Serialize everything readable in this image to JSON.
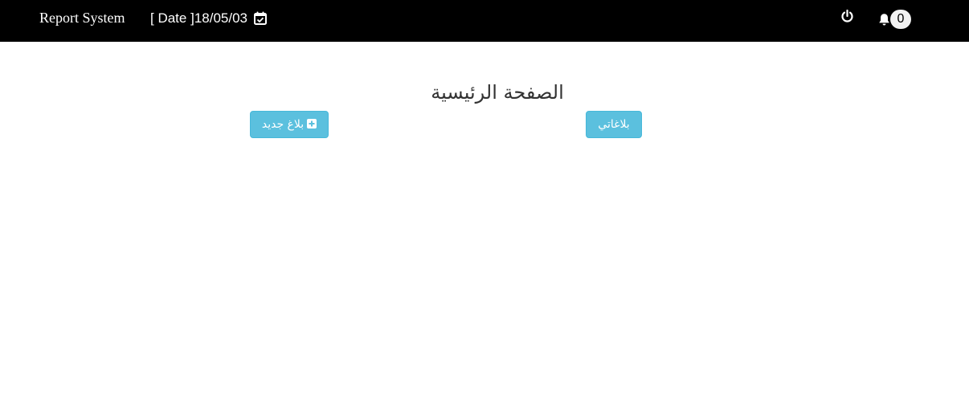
{
  "navbar": {
    "brand": "Report System",
    "date_label": "[ Date ]",
    "date_value": "18/05/03",
    "notification_count": "0",
    "icons": [
      "calendar-check-icon",
      "power-icon",
      "bell-icon"
    ]
  },
  "main": {
    "title": "الصفحة الرئيسية",
    "buttons": {
      "new_report": "بلاغ جديد",
      "my_reports": "بلاغاتي"
    }
  },
  "colors": {
    "navbar_bg": "#000000",
    "button_bg": "#5bc0de",
    "button_border": "#46b8da",
    "title_text": "#333333"
  }
}
